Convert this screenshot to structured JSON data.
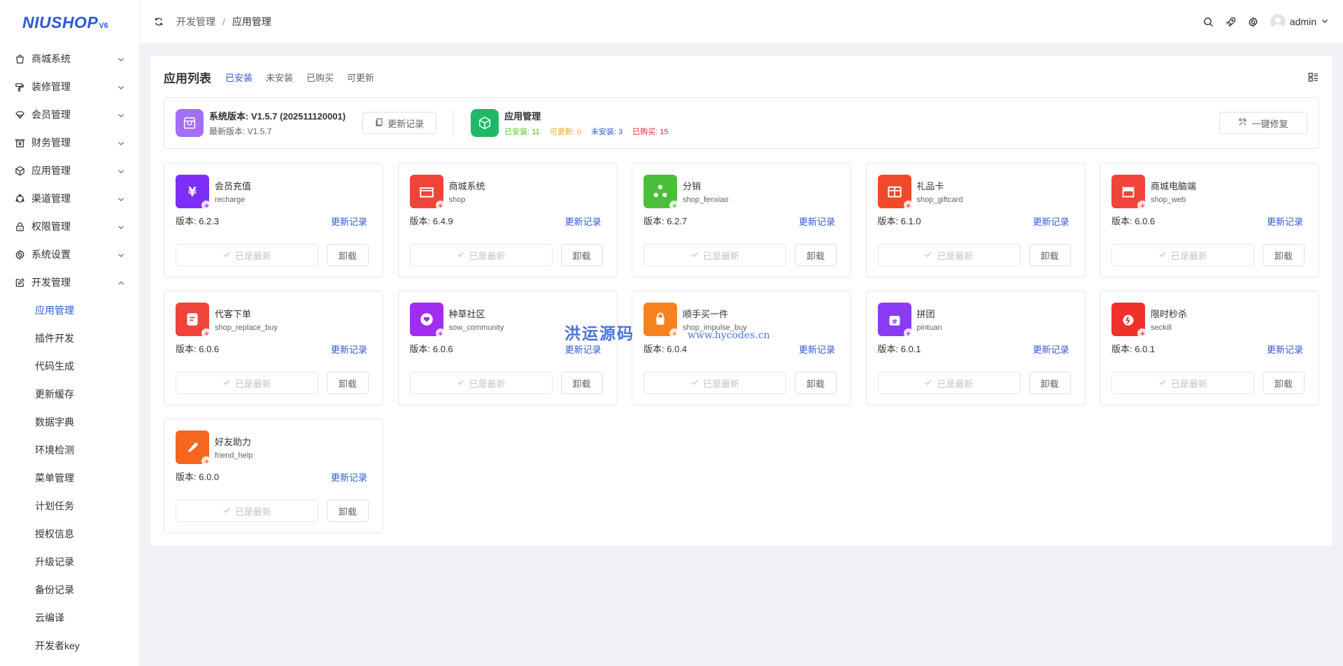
{
  "logo": {
    "text": "NIUSHOP",
    "sub": "V6"
  },
  "sidebar": {
    "items": [
      {
        "label": "商城系统",
        "icon": "shopping-bag-icon"
      },
      {
        "label": "装修管理",
        "icon": "brush-icon"
      },
      {
        "label": "会员管理",
        "icon": "member-diamond-icon"
      },
      {
        "label": "财务管理",
        "icon": "finance-icon"
      },
      {
        "label": "应用管理",
        "icon": "cube-icon"
      },
      {
        "label": "渠道管理",
        "icon": "channel-icon"
      },
      {
        "label": "权限管理",
        "icon": "lock-icon"
      },
      {
        "label": "系统设置",
        "icon": "gear-icon"
      },
      {
        "label": "开发管理",
        "icon": "edit-icon",
        "expanded": true
      }
    ],
    "sub_items": [
      "应用管理",
      "插件开发",
      "代码生成",
      "更新缓存",
      "数据字典",
      "环境检测",
      "菜单管理",
      "计划任务",
      "授权信息",
      "升级记录",
      "备份记录",
      "云编译",
      "开发者key"
    ],
    "active_sub": "应用管理"
  },
  "header": {
    "breadcrumb": [
      "开发管理",
      "应用管理"
    ],
    "separator": "/",
    "username": "admin"
  },
  "panel": {
    "title": "应用列表",
    "tabs": [
      "已安装",
      "未安装",
      "已购买",
      "可更新"
    ],
    "active_tab": "已安装"
  },
  "system": {
    "version_label": "系统版本: V1.5.7 (202511120001)",
    "latest_label": "最新版本: V1.5.7",
    "log_button": "更新记录",
    "app_mgr_title": "应用管理",
    "stats": {
      "installed": "已安装: 11",
      "updatable": "可更新: 0",
      "not_installed": "未安装: 3",
      "purchased": "已购买: 15"
    },
    "repair_button": "一键修复"
  },
  "card_labels": {
    "log_link": "更新记录",
    "latest": "已是最新",
    "uninstall": "卸载"
  },
  "apps": [
    {
      "name": "会员充值",
      "key": "recharge",
      "version": "版本: 6.2.3",
      "color": "#7b2ff7"
    },
    {
      "name": "商城系统",
      "key": "shop",
      "version": "版本: 6.4.9",
      "color": "#f0443a"
    },
    {
      "name": "分销",
      "key": "shop_fenxiao",
      "version": "版本: 6.2.7",
      "color": "#4cbf3a"
    },
    {
      "name": "礼品卡",
      "key": "shop_giftcard",
      "version": "版本: 6.1.0",
      "color": "#f04a2a"
    },
    {
      "name": "商城电脑端",
      "key": "shop_web",
      "version": "版本: 6.0.6",
      "color": "#f0443a"
    },
    {
      "name": "代客下单",
      "key": "shop_replace_buy",
      "version": "版本: 6.0.6",
      "color": "#f0443a"
    },
    {
      "name": "种草社区",
      "key": "sow_community",
      "version": "版本: 6.0.6",
      "color": "#a22cf0"
    },
    {
      "name": "顺手买一件",
      "key": "shop_impulse_buy",
      "version": "版本: 6.0.4",
      "color": "#f5821f"
    },
    {
      "name": "拼团",
      "key": "pintuan",
      "version": "版本: 6.0.1",
      "color": "#8a3cf5"
    },
    {
      "name": "限时秒杀",
      "key": "seckill",
      "version": "版本: 6.0.1",
      "color": "#f0302a"
    },
    {
      "name": "好友助力",
      "key": "friend_help",
      "version": "版本: 6.0.0",
      "color": "#f5661f"
    }
  ],
  "watermark": {
    "text": "洪运源码",
    "url": "www.hycodes.cn"
  }
}
